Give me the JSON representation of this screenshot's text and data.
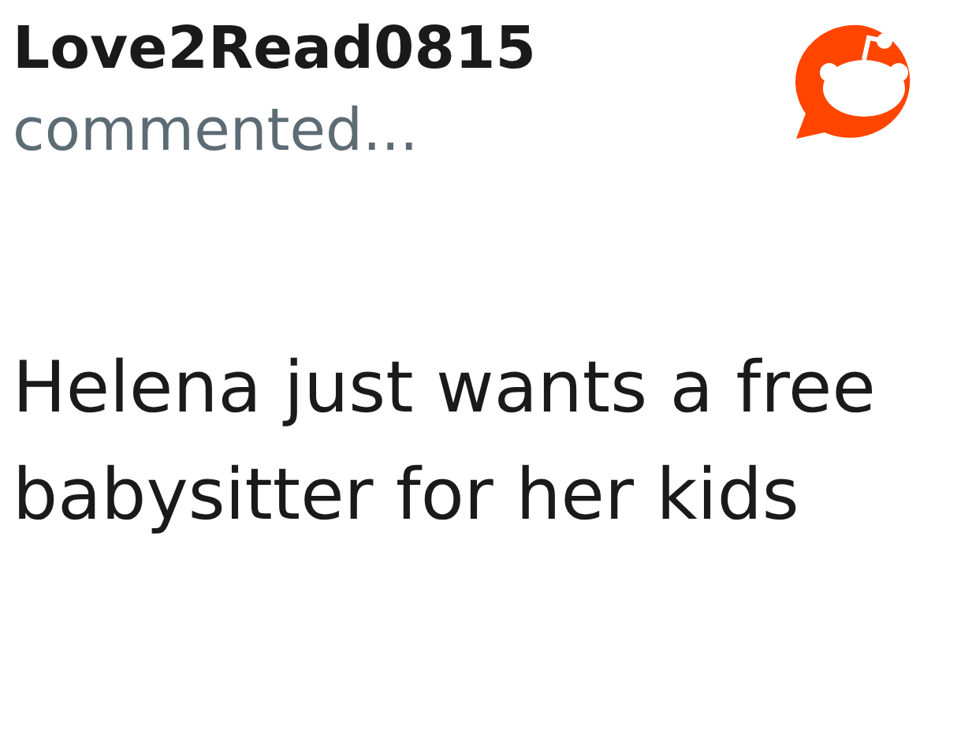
{
  "comment": {
    "author": "Love2Read0815",
    "action": "commented...",
    "body": "Helena just wants a free babysitter for her kids"
  }
}
